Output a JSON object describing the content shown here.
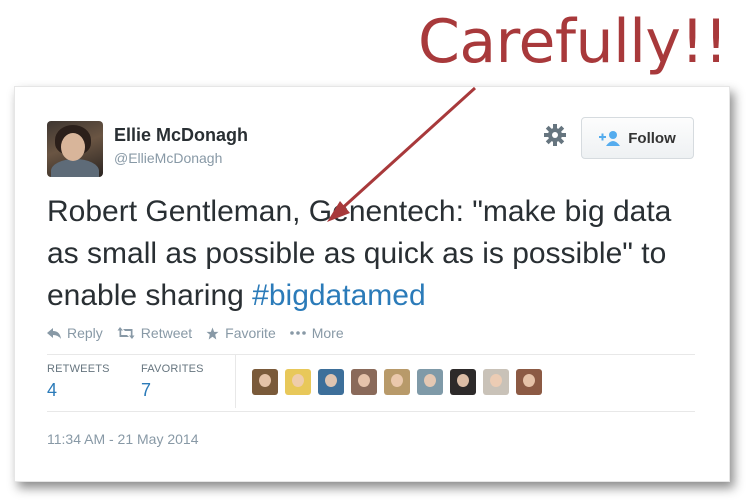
{
  "annotation": {
    "text": "Carefully!!",
    "color": "#a8393b"
  },
  "tweet": {
    "author_name": "Ellie McDonagh",
    "author_handle": "@EllieMcDonagh",
    "follow_label": "Follow",
    "text_main": "Robert Gentleman, Genentech: \"make big data as small as possible as quick as is possible\" to enable sharing ",
    "hashtag": "#bigdatamed",
    "actions": {
      "reply": "Reply",
      "retweet": "Retweet",
      "favorite": "Favorite",
      "more": "More"
    },
    "stats": {
      "retweets_label": "RETWEETS",
      "retweets_value": "4",
      "favorites_label": "FAVORITES",
      "favorites_value": "7"
    },
    "favoriter_avatars": [
      "avatar-1",
      "avatar-2",
      "avatar-3",
      "avatar-4",
      "avatar-5",
      "avatar-6",
      "avatar-7",
      "avatar-8",
      "avatar-9"
    ],
    "timestamp": "11:34 AM - 21 May 2014"
  },
  "colors": {
    "link": "#2b7bb9",
    "text": "#292f33",
    "muted": "#8899a6"
  }
}
